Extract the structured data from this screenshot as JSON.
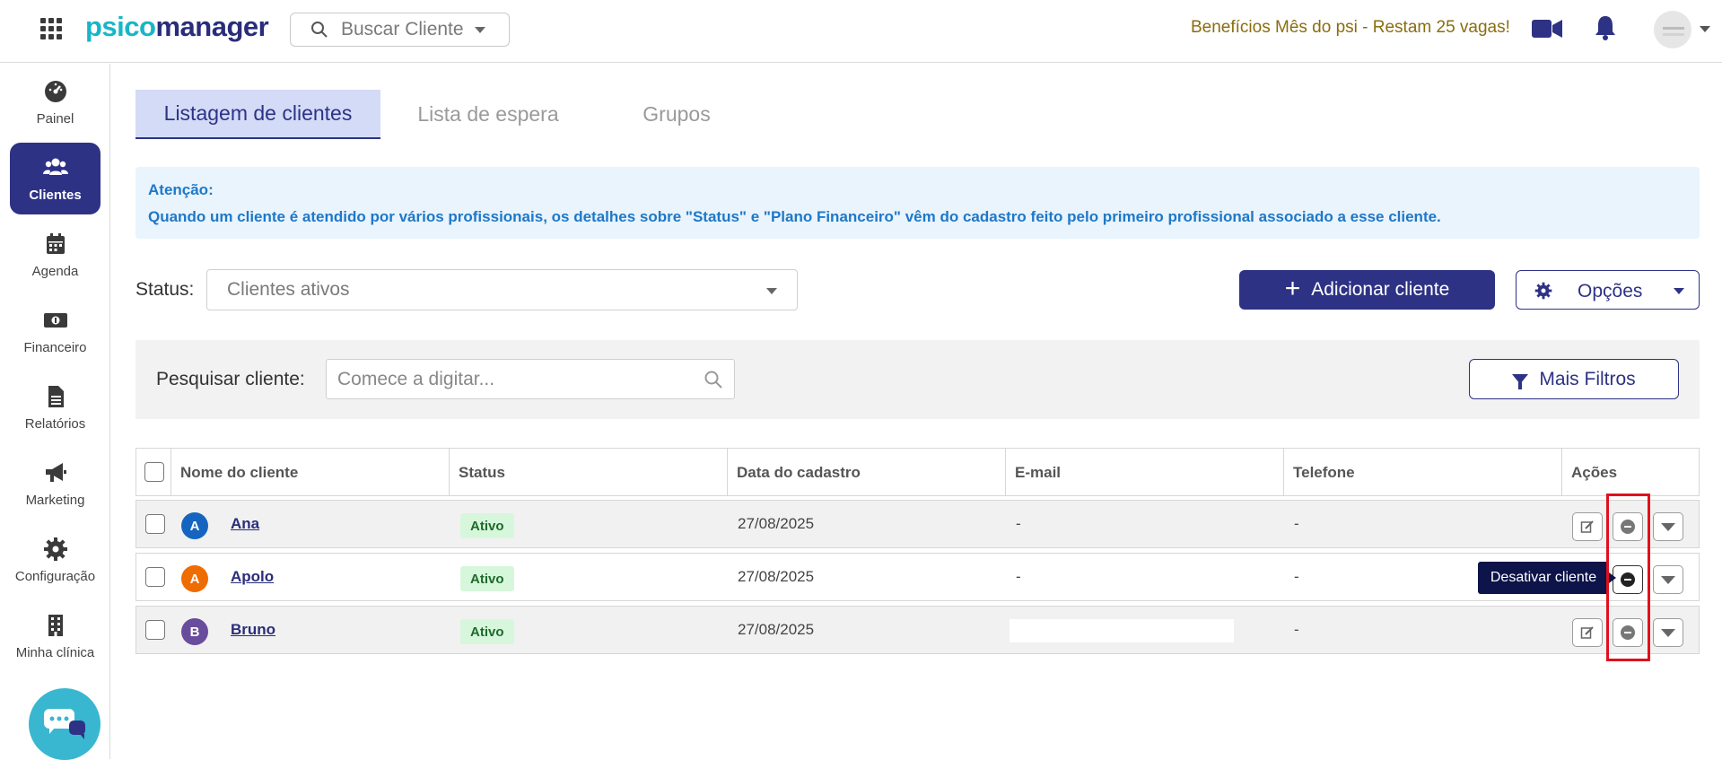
{
  "topbar": {
    "logo_part1": "psico",
    "logo_part2": "manager",
    "search_placeholder": "Buscar Cliente",
    "promo_text": "Benefícios Mês do psi - Restam 25 vagas!"
  },
  "sidebar": {
    "items": [
      {
        "label": "Painel",
        "icon": "dashboard-icon"
      },
      {
        "label": "Clientes",
        "icon": "users-icon",
        "active": true
      },
      {
        "label": "Agenda",
        "icon": "calendar-icon"
      },
      {
        "label": "Financeiro",
        "icon": "money-icon"
      },
      {
        "label": "Relatórios",
        "icon": "document-icon"
      },
      {
        "label": "Marketing",
        "icon": "megaphone-icon"
      },
      {
        "label": "Configuração",
        "icon": "gear-icon"
      },
      {
        "label": "Minha clínica",
        "icon": "building-icon"
      }
    ]
  },
  "tabs": [
    {
      "label": "Listagem de clientes",
      "active": true
    },
    {
      "label": "Lista de espera"
    },
    {
      "label": "Grupos"
    }
  ],
  "alert": {
    "title": "Atenção:",
    "message": "Quando um cliente é atendido por vários profissionais, os detalhes sobre \"Status\" e \"Plano Financeiro\" vêm do cadastro feito pelo primeiro profissional associado a esse cliente."
  },
  "filters": {
    "status_label": "Status:",
    "status_value": "Clientes ativos",
    "add_button": "Adicionar cliente",
    "options_button": "Opções",
    "search_label": "Pesquisar cliente:",
    "search_placeholder": "Comece a digitar...",
    "more_filters_button": "Mais Filtros"
  },
  "table": {
    "columns": [
      "Nome do cliente",
      "Status",
      "Data do cadastro",
      "E-mail",
      "Telefone",
      "Ações"
    ],
    "rows": [
      {
        "initial": "A",
        "avatar_color": "#1565c0",
        "name": "Ana",
        "status": "Ativo",
        "date": "27/08/2025",
        "email": "-",
        "phone": "-"
      },
      {
        "initial": "A",
        "avatar_color": "#ef6c00",
        "name": "Apolo",
        "status": "Ativo",
        "date": "27/08/2025",
        "email": "-",
        "phone": "-"
      },
      {
        "initial": "B",
        "avatar_color": "#6a4c9c",
        "name": "Bruno",
        "status": "Ativo",
        "date": "27/08/2025",
        "email": "",
        "phone": "-"
      }
    ]
  },
  "tooltip": {
    "text": "Desativar cliente"
  },
  "colors": {
    "primary": "#2e3285",
    "accent": "#17b6c7",
    "highlight": "#e0101f"
  }
}
